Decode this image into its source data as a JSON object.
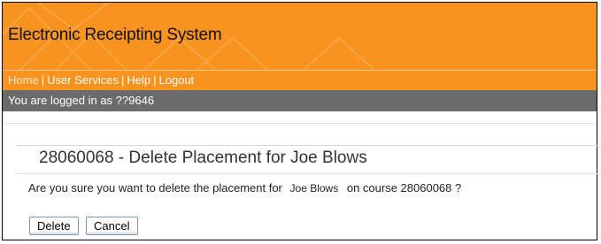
{
  "header": {
    "title": "Electronic Receipting System"
  },
  "nav": {
    "items": [
      "Home",
      "User Services",
      "Help",
      "Logout"
    ],
    "separator": "|"
  },
  "status": {
    "logged_in_text": "You are logged in as ??9646"
  },
  "page": {
    "title": "28060068 - Delete Placement for Joe Blows",
    "confirm_prefix": "Are you sure you want to delete the placement for",
    "student_name": "Joe Blows",
    "confirm_suffix": "on course 28060068 ?"
  },
  "actions": {
    "delete_label": "Delete",
    "cancel_label": "Cancel"
  },
  "colors": {
    "header_orange": "#f7931e",
    "status_gray": "#6b6b6b"
  }
}
